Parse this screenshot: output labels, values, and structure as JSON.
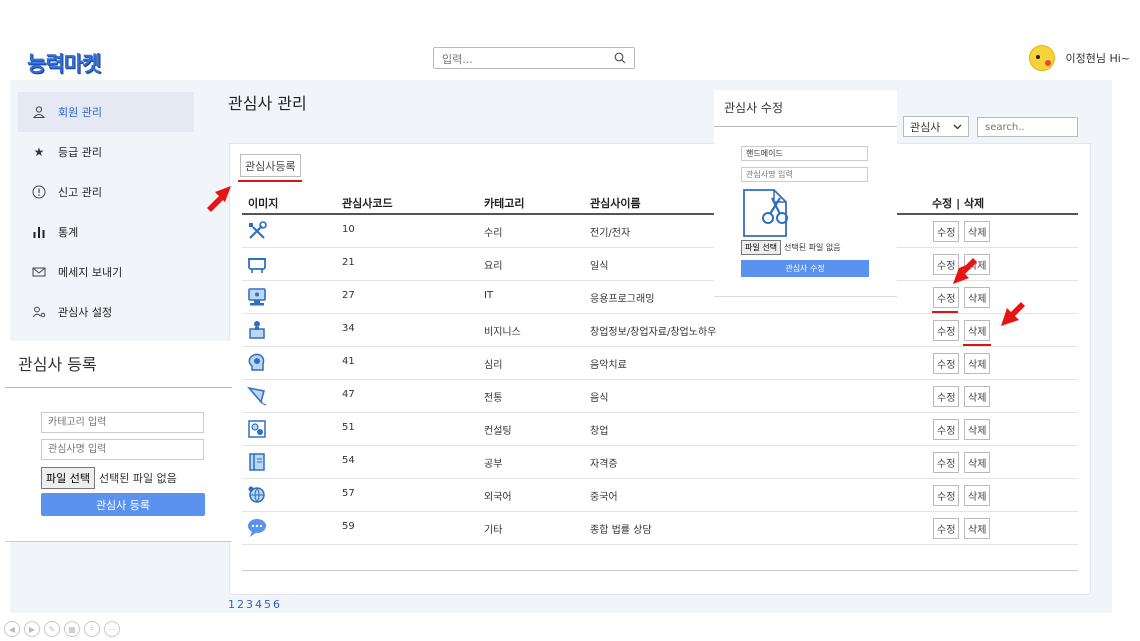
{
  "header": {
    "logo": "능력마켓",
    "search_placeholder": "입력...",
    "user_greeting": "이정현님 Hi~"
  },
  "sidebar": {
    "items": [
      {
        "label": "회원 관리",
        "icon": "user-icon",
        "active": true
      },
      {
        "label": "등급 관리",
        "icon": "star-icon",
        "active": false
      },
      {
        "label": "신고 관리",
        "icon": "alert-circle-icon",
        "active": false
      },
      {
        "label": "통계",
        "icon": "bar-chart-icon",
        "active": false
      },
      {
        "label": "메세지 보내기",
        "icon": "mail-icon",
        "active": false
      },
      {
        "label": "관심사 설정",
        "icon": "user-settings-icon",
        "active": false
      }
    ]
  },
  "main": {
    "title": "관심사 관리",
    "register_button": "관심사등록",
    "filter_select": "관심사",
    "filter_search_placeholder": "search..",
    "columns": [
      "이미지",
      "관심사코드",
      "카테고리",
      "관심사이름",
      "수정 | 삭제"
    ],
    "edit_label": "수정",
    "delete_label": "삭제",
    "rows": [
      {
        "code": "10",
        "category": "수리",
        "name": "전기/전자",
        "icon": "tools-icon"
      },
      {
        "code": "21",
        "category": "요리",
        "name": "일식",
        "icon": "cooking-pot-icon"
      },
      {
        "code": "27",
        "category": "IT",
        "name": "응용프로그래밍",
        "icon": "computer-icon"
      },
      {
        "code": "34",
        "category": "비지니스",
        "name": "창업정보/창업자료/창업노하우",
        "icon": "business-icon"
      },
      {
        "code": "41",
        "category": "심리",
        "name": "음악치료",
        "icon": "head-icon"
      },
      {
        "code": "47",
        "category": "전통",
        "name": "음식",
        "icon": "kite-icon"
      },
      {
        "code": "51",
        "category": "컨설팅",
        "name": "창업",
        "icon": "consulting-icon"
      },
      {
        "code": "54",
        "category": "공부",
        "name": "자격증",
        "icon": "book-icon"
      },
      {
        "code": "57",
        "category": "외국어",
        "name": "중국어",
        "icon": "globe-icon"
      },
      {
        "code": "59",
        "category": "기타",
        "name": "종합 법률 상담",
        "icon": "chat-bubble-icon"
      }
    ],
    "pages": [
      "1",
      "2",
      "3",
      "4",
      "5",
      "6"
    ]
  },
  "edit_popup": {
    "title": "관심사 수정",
    "category_value": "핸드메이드",
    "name_placeholder": "관심사명 입력",
    "file_button": "파일 선택",
    "file_status": "선택된 파일 없음",
    "submit": "관심사 수정",
    "image_icon": "scissors-document-icon"
  },
  "register_popup": {
    "title": "관심사 등록",
    "category_placeholder": "카테고리 입력",
    "name_placeholder": "관심사명 입력",
    "file_button": "파일 선택",
    "file_status": "선택된 파일 없음",
    "submit": "관심사 등록"
  },
  "colors": {
    "accent": "#2f5fd0",
    "button_blue": "#5b92ef",
    "annotation_red": "#d81414"
  }
}
